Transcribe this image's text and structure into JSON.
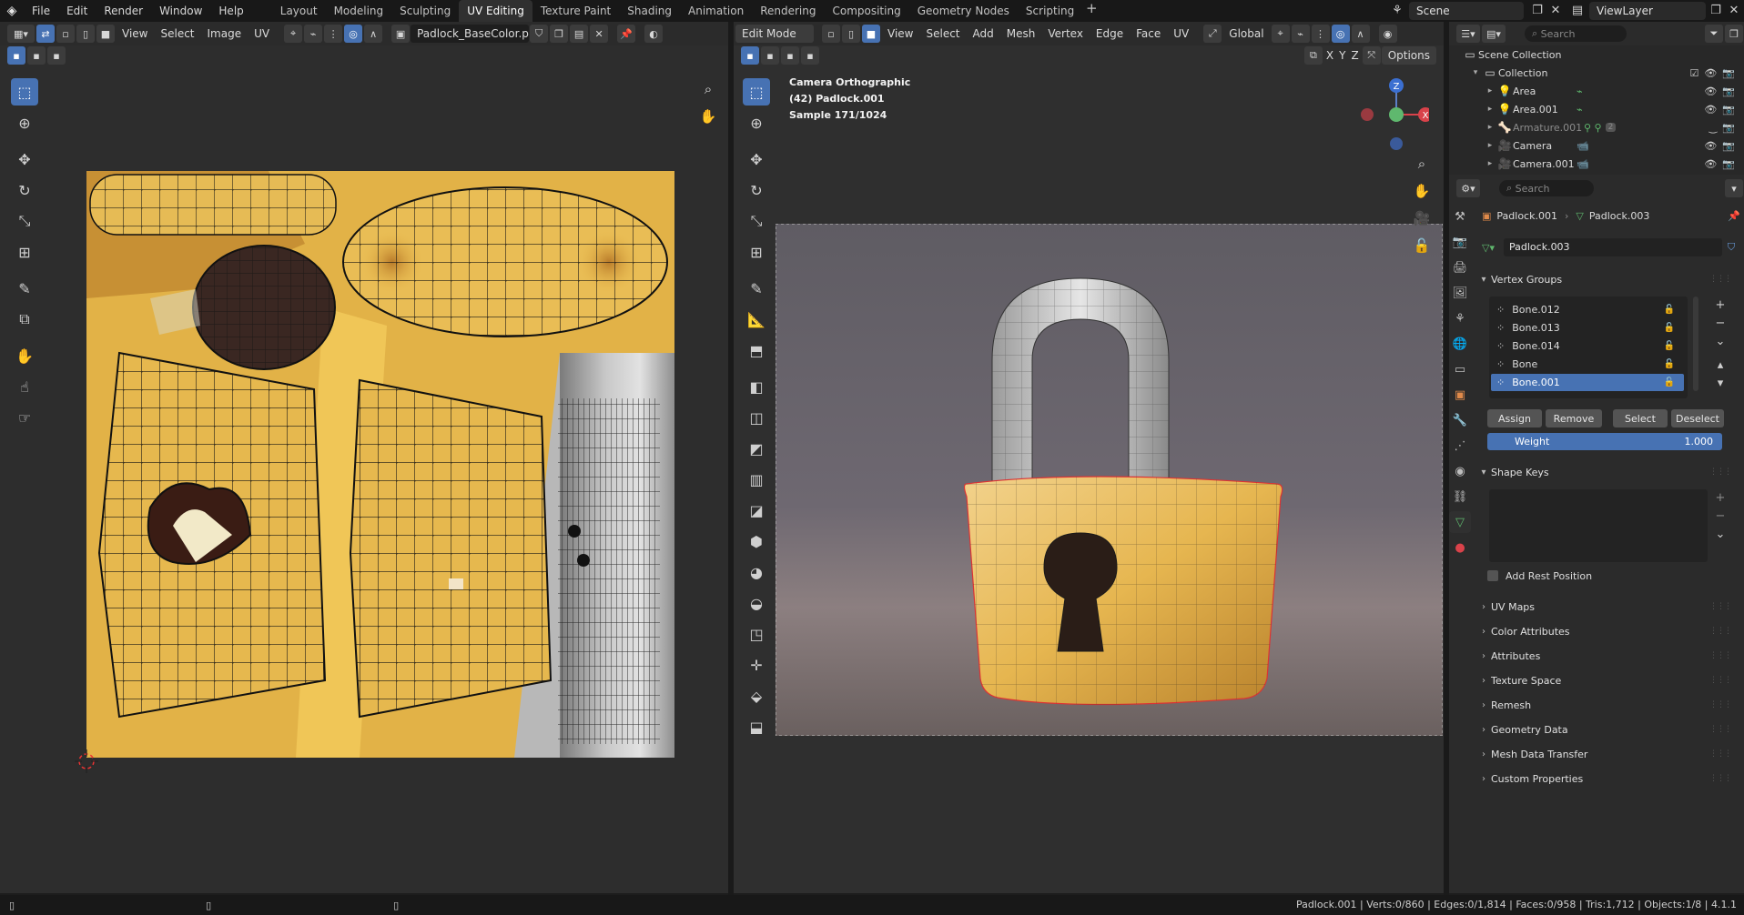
{
  "topbar": {
    "menus": [
      "File",
      "Edit",
      "Render",
      "Window",
      "Help"
    ],
    "workspaces": [
      "Layout",
      "Modeling",
      "Sculpting",
      "UV Editing",
      "Texture Paint",
      "Shading",
      "Animation",
      "Rendering",
      "Compositing",
      "Geometry Nodes",
      "Scripting"
    ],
    "active_workspace": "UV Editing",
    "add_label": "+",
    "scene": "Scene",
    "view_layer": "ViewLayer"
  },
  "uv_editor": {
    "menus": [
      "View",
      "Select",
      "Image",
      "UV"
    ],
    "image_name": "Padlock_BaseColor.png"
  },
  "viewport": {
    "mode": "Edit Mode",
    "menus": [
      "View",
      "Select",
      "Add",
      "Mesh",
      "Vertex",
      "Edge",
      "Face",
      "UV"
    ],
    "transform_orientation": "Global",
    "axes": [
      "X",
      "Y",
      "Z"
    ],
    "options_label": "Options",
    "overlay": {
      "camera": "Camera Orthographic",
      "object": "(42) Padlock.001",
      "sample": "Sample 171/1024"
    },
    "gizmo": {
      "x": "X",
      "z": "Z"
    }
  },
  "outliner": {
    "search_placeholder": "Search",
    "scene_collection": "Scene Collection",
    "collection": "Collection",
    "items": [
      {
        "name": "Area"
      },
      {
        "name": "Area.001"
      },
      {
        "name": "Armature.001",
        "badge": "2"
      },
      {
        "name": "Camera"
      },
      {
        "name": "Camera.001"
      }
    ]
  },
  "properties": {
    "search_placeholder": "Search",
    "breadcrumb_object": "Padlock.001",
    "breadcrumb_mesh": "Padlock.003",
    "mesh_name": "Padlock.003",
    "vertex_groups_title": "Vertex Groups",
    "vertex_groups": [
      "Bone.012",
      "Bone.013",
      "Bone.014",
      "Bone",
      "Bone.001"
    ],
    "selected_group": "Bone.001",
    "buttons": {
      "assign": "Assign",
      "remove": "Remove",
      "select": "Select",
      "deselect": "Deselect"
    },
    "weight_label": "Weight",
    "weight_value": "1.000",
    "shape_keys_title": "Shape Keys",
    "add_rest_position": "Add Rest Position",
    "sections": [
      "UV Maps",
      "Color Attributes",
      "Attributes",
      "Texture Space",
      "Remesh",
      "Geometry Data",
      "Mesh Data Transfer",
      "Custom Properties"
    ]
  },
  "statusbar": {
    "text": "Padlock.001 | Verts:0/860 | Edges:0/1,814 | Faces:0/958 | Tris:1,712 | Objects:1/8 | 4.1.1"
  },
  "colors": {
    "accent": "#4772b3",
    "texture_yellow": "#e8b84a",
    "grey_strip": "#a8a8a8"
  }
}
